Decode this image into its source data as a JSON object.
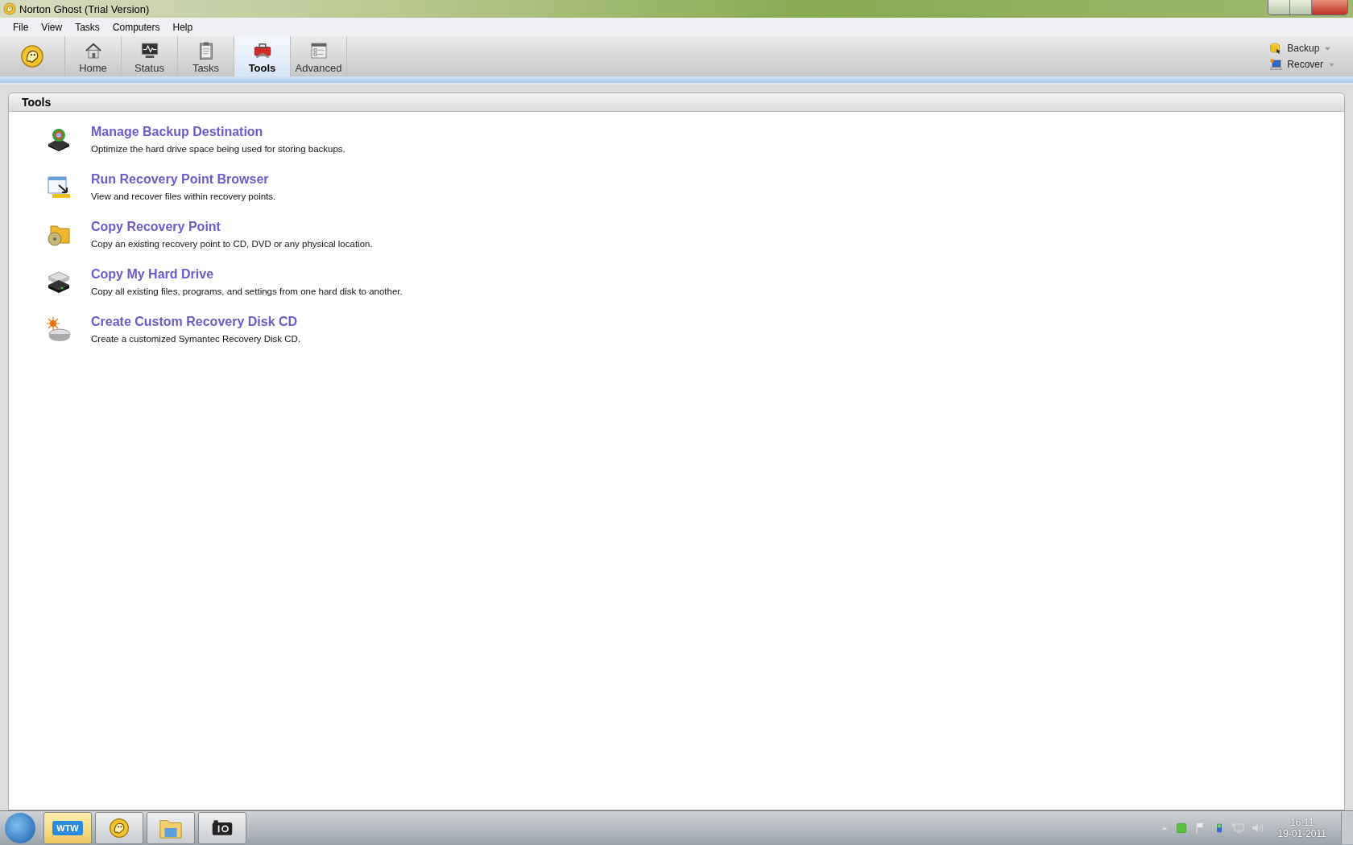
{
  "window": {
    "title": "Norton Ghost (Trial Version)"
  },
  "menu": [
    "File",
    "View",
    "Tasks",
    "Computers",
    "Help"
  ],
  "tabs": [
    {
      "label": "Home",
      "kind": "home",
      "selected": false
    },
    {
      "label": "Status",
      "kind": "status",
      "selected": false
    },
    {
      "label": "Tasks",
      "kind": "tasks",
      "selected": false
    },
    {
      "label": "Tools",
      "kind": "tools",
      "selected": true
    },
    {
      "label": "Advanced",
      "kind": "advanced",
      "selected": false
    }
  ],
  "quick_actions": [
    {
      "label": "Backup",
      "kind": "backup"
    },
    {
      "label": "Recover",
      "kind": "recover"
    }
  ],
  "panel": {
    "title": "Tools",
    "items": [
      {
        "kind": "destination",
        "title": "Manage Backup Destination",
        "description": "Optimize the hard drive space being used for storing backups."
      },
      {
        "kind": "browser",
        "title": "Run Recovery Point Browser",
        "description": "View and recover files within recovery points."
      },
      {
        "kind": "copy-point",
        "title": "Copy Recovery Point",
        "description": "Copy an existing recovery point to CD, DVD or any physical location."
      },
      {
        "kind": "copy-drive",
        "title": "Copy My Hard Drive",
        "description": "Copy all existing files, programs, and settings from one hard disk to another."
      },
      {
        "kind": "disk",
        "title": "Create Custom Recovery Disk CD",
        "description": "Create a customized Symantec Recovery Disk CD."
      }
    ]
  },
  "taskbar": {
    "apps": [
      {
        "kind": "wtw",
        "label": "WTW",
        "selected": true
      },
      {
        "kind": "ghost",
        "selected": false
      },
      {
        "kind": "folder",
        "selected": false
      },
      {
        "kind": "camera",
        "selected": false
      }
    ],
    "time": "16:11",
    "date": "19-01-2011"
  }
}
